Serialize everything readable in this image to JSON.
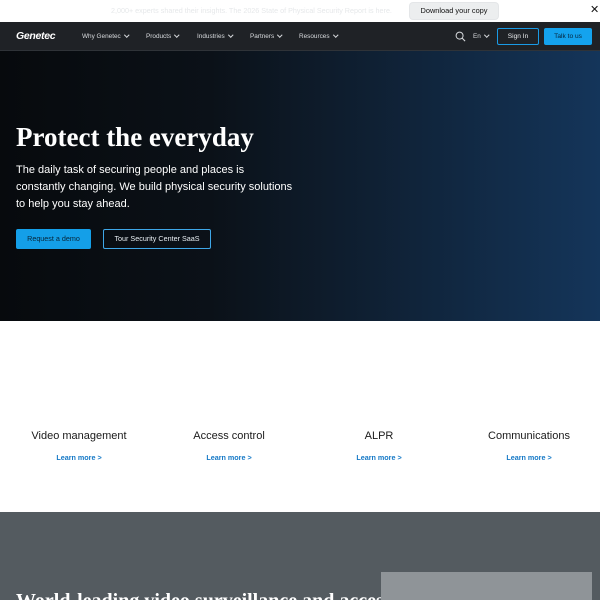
{
  "announcement": {
    "text": "2,000+ experts shared their insights. The 2026 State of Physical Security Report is here.",
    "button_label": "Download your copy",
    "close_label": "✕"
  },
  "nav": {
    "logo": "Genetec",
    "items": [
      {
        "label": "Why Genetec"
      },
      {
        "label": "Products"
      },
      {
        "label": "Industries"
      },
      {
        "label": "Partners"
      },
      {
        "label": "Resources"
      }
    ],
    "language": "En",
    "signin_label": "Sign In",
    "talk_label": "Talk to us"
  },
  "hero": {
    "title": "Protect the everyday",
    "subtitle": "The daily task of securing people and places is constantly changing. We build physical security solutions to help you stay ahead.",
    "primary_button": "Request a demo",
    "secondary_button": "Tour Security Center SaaS"
  },
  "products": [
    {
      "title": "Video management",
      "link": "Learn more >"
    },
    {
      "title": "Access control",
      "link": "Learn more >"
    },
    {
      "title": "ALPR",
      "link": "Learn more >"
    },
    {
      "title": "Communications",
      "link": "Learn more >"
    }
  ],
  "bottom": {
    "title": "World-leading video surveillance and access"
  },
  "colors": {
    "accent": "#149fe8",
    "link": "#1478c6",
    "nav_bg": "#1f2226",
    "bottom_bg": "#545b60"
  }
}
